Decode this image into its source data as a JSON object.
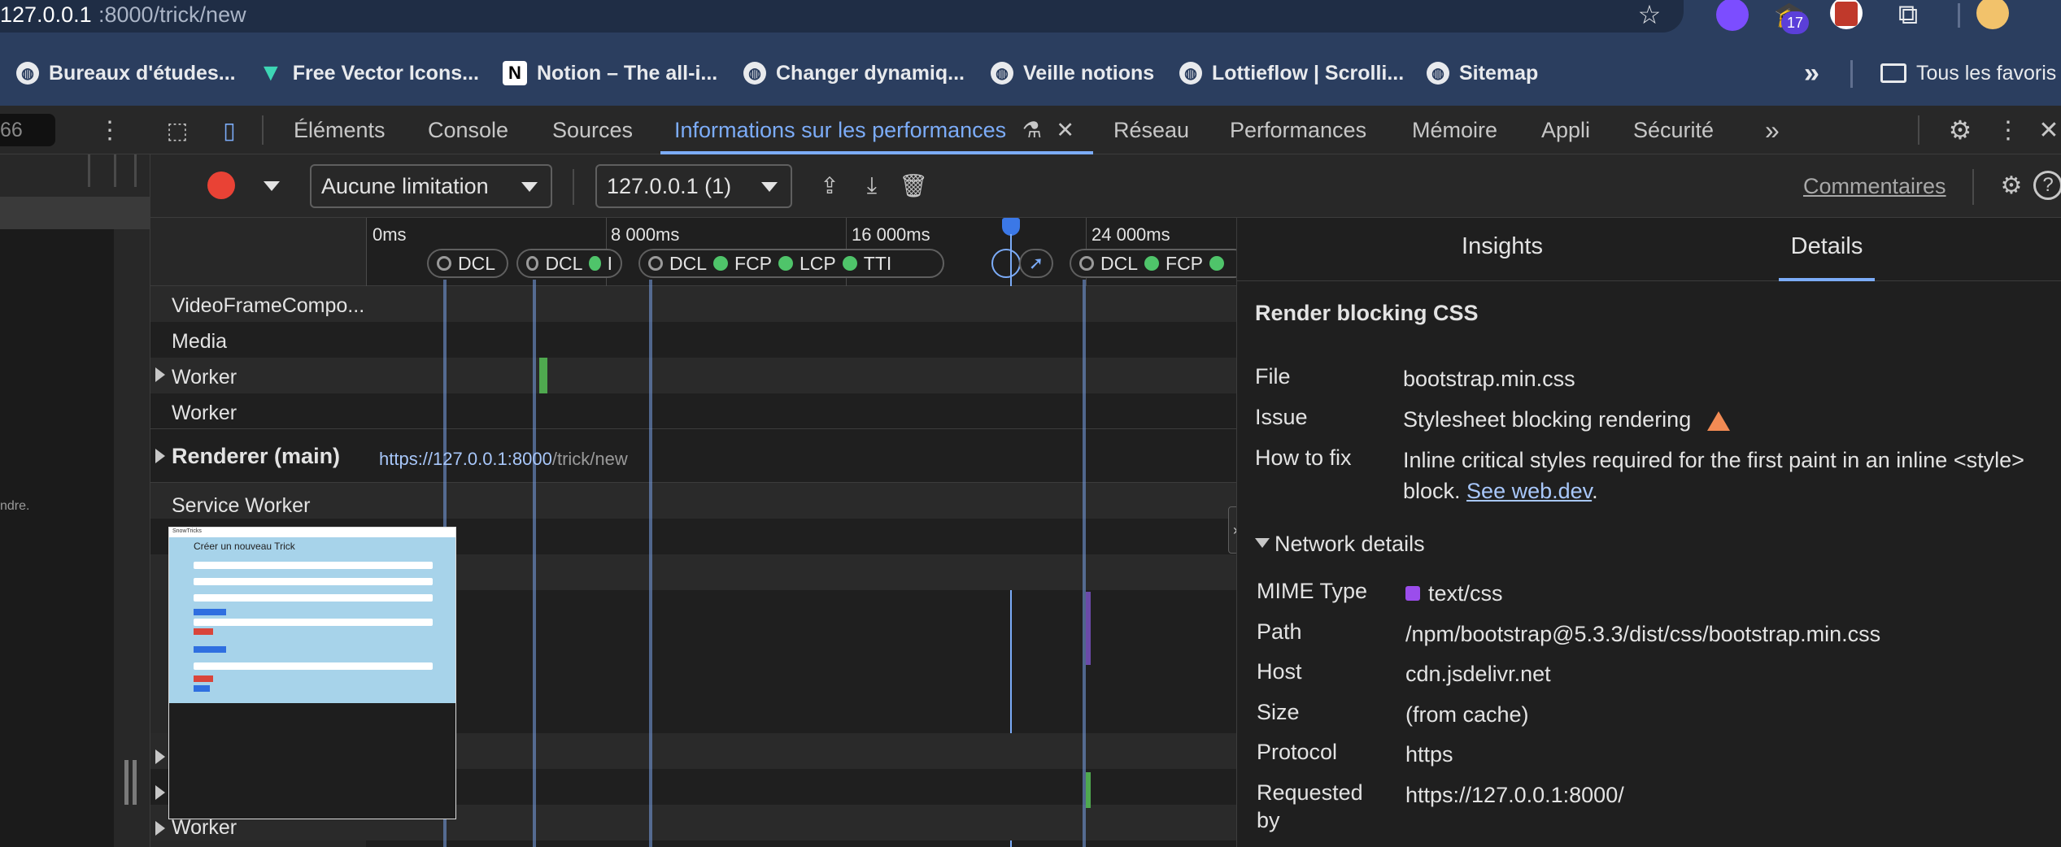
{
  "url_bar": {
    "host": "127.0.0.1",
    "rest": ":8000/trick/new"
  },
  "extensions": {
    "badge_count": "17"
  },
  "bookmarks": [
    {
      "label": "Bureaux d'études..."
    },
    {
      "label": "Free Vector Icons..."
    },
    {
      "label": "Notion – The all-i..."
    },
    {
      "label": "Changer dynamiq..."
    },
    {
      "label": "Veille notions"
    },
    {
      "label": "Lottieflow | Scrolli..."
    },
    {
      "label": "Sitemap"
    }
  ],
  "bookmarks_more": "»",
  "all_bookmarks": "Tous les favoris",
  "left_counter": "66",
  "devtools_tabs": [
    {
      "label": "Éléments"
    },
    {
      "label": "Console"
    },
    {
      "label": "Sources"
    },
    {
      "label": "Informations sur les performances"
    },
    {
      "label": "Réseau"
    },
    {
      "label": "Performances"
    },
    {
      "label": "Mémoire"
    },
    {
      "label": "Appli"
    },
    {
      "label": "Sécurité"
    }
  ],
  "toolbar": {
    "throttling": "Aucune limitation",
    "target": "127.0.0.1 (1)",
    "feedback": "Commentaires"
  },
  "ruler": {
    "t0": "0ms",
    "t1": "8 000ms",
    "t2": "16 000ms",
    "t3": "24 000ms"
  },
  "markers": {
    "group1": "DCL",
    "group2a": "DCL",
    "group2b": "I",
    "group3a": "DCL",
    "group3b": "FCP",
    "group3c": "LCP",
    "group3d": "TTI",
    "group4a": "DCL",
    "group4b": "FCP"
  },
  "tracks": {
    "t1": "VideoFrameCompo...",
    "t2": "Media",
    "t3": "Worker",
    "t4": "Worker",
    "t5": "Renderer (main)",
    "t5_url_host": "https://127.0.0.1:8000",
    "t5_url_path": "/trick/new",
    "t6": "Service Worker",
    "t7": "Worker"
  },
  "left_clip_text": "ndre.",
  "thumbnail": {
    "title": "Créer un nouveau Trick",
    "brand": "SnowTricks"
  },
  "right_panel": {
    "tabs": [
      {
        "label": "Insights"
      },
      {
        "label": "Details"
      }
    ],
    "heading": "Render blocking CSS",
    "file_key": "File",
    "file_val": "bootstrap.min.css",
    "issue_key": "Issue",
    "issue_val": "Stylesheet blocking rendering",
    "fix_key": "How to fix",
    "fix_line1": "Inline critical styles required for the first paint in an inline <style>",
    "fix_line2_prefix": "block. ",
    "fix_link": "See web.dev",
    "fix_suffix": ".",
    "network_heading": "Network details",
    "mime_key": "MIME Type",
    "mime_val": "text/css",
    "path_key": "Path",
    "path_val": "/npm/bootstrap@5.3.3/dist/css/bootstrap.min.css",
    "host_key": "Host",
    "host_val": "cdn.jsdelivr.net",
    "size_key": "Size",
    "size_val": "(from cache)",
    "protocol_key": "Protocol",
    "protocol_val": "https",
    "requested_key_1": "Requested",
    "requested_key_2": "by",
    "requested_val": "https://127.0.0.1:8000/"
  },
  "colors": {
    "accent": "#7cacf8",
    "record": "#e94235",
    "css_purple": "#9b4dec",
    "warning": "#f28b54",
    "marker_green": "#4fc46a"
  }
}
